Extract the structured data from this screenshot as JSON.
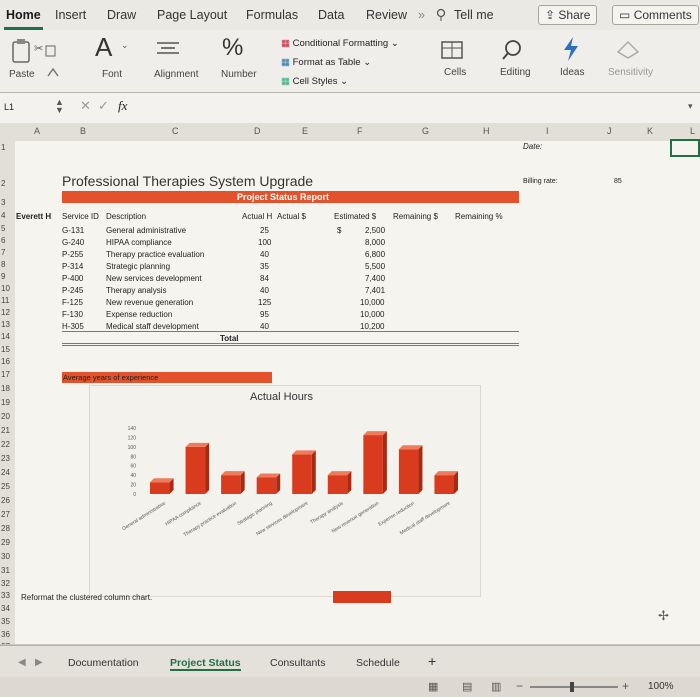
{
  "ribbon_tabs": [
    "Home",
    "Insert",
    "Draw",
    "Page Layout",
    "Formulas",
    "Data",
    "Review"
  ],
  "tell_me": "Tell me",
  "share_label": "Share",
  "comments_label": "Comments",
  "ribbon": {
    "paste": "Paste",
    "font": "Font",
    "alignment": "Alignment",
    "number": "Number",
    "conditional_formatting": "Conditional Formatting",
    "format_as_table": "Format as Table",
    "cell_styles": "Cell Styles",
    "cells": "Cells",
    "editing": "Editing",
    "ideas": "Ideas",
    "sensitivity": "Sensitivity",
    "font_glyph": "A",
    "number_glyph": "%"
  },
  "formula_bar": {
    "name_box": "L1",
    "fx": "fx",
    "formula": ""
  },
  "columns": [
    "A",
    "B",
    "C",
    "D",
    "E",
    "F",
    "G",
    "H",
    "I",
    "J",
    "K",
    "L"
  ],
  "rows": [
    "1",
    "2",
    "3",
    "4",
    "5",
    "6",
    "7",
    "8",
    "9",
    "10",
    "11",
    "12",
    "13",
    "14",
    "15",
    "16",
    "17",
    "18",
    "19",
    "20",
    "21",
    "22",
    "23",
    "24",
    "25",
    "26",
    "27",
    "28",
    "29",
    "30",
    "31",
    "32",
    "33",
    "34",
    "35",
    "36",
    "37"
  ],
  "sheet": {
    "title": "Professional Therapies System Upgrade",
    "banner": "Project Status Report",
    "date_label": "Date:",
    "billing_label": "Billing rate:",
    "billing_value": "85",
    "manager_cut": "Everett H",
    "headers": [
      "Service ID",
      "Description",
      "Actual H",
      "Actual $",
      "Estimated $",
      "Remaining $",
      "Remaining %"
    ],
    "rows": [
      {
        "id": "G-131",
        "desc": "General administrative",
        "hours": "25",
        "est": "2,500"
      },
      {
        "id": "G-240",
        "desc": "HIPAA compliance",
        "hours": "100",
        "est": "8,000"
      },
      {
        "id": "P-255",
        "desc": "Therapy practice evaluation",
        "hours": "40",
        "est": "6,800"
      },
      {
        "id": "P-314",
        "desc": "Strategic planning",
        "hours": "35",
        "est": "5,500"
      },
      {
        "id": "P-400",
        "desc": "New services development",
        "hours": "84",
        "est": "7,400"
      },
      {
        "id": "P-245",
        "desc": "Therapy analysis",
        "hours": "40",
        "est": "7,401"
      },
      {
        "id": "F-125",
        "desc": "New revenue generation",
        "hours": "125",
        "est": "10,000"
      },
      {
        "id": "F-130",
        "desc": "Expense reduction",
        "hours": "95",
        "est": "10,000"
      },
      {
        "id": "H-305",
        "desc": "Medical staff development",
        "hours": "40",
        "est": "10,200"
      }
    ],
    "dollar_sign": "$",
    "total_label": "Total",
    "avg_label": "Average years of experience",
    "instruction": "Reformat the clustered column chart."
  },
  "chart_data": {
    "type": "bar",
    "title": "Actual Hours",
    "categories": [
      "General administrative",
      "HIPAA compliance",
      "Therapy practice evaluation",
      "Strategic planning",
      "New services development",
      "Therapy analysis",
      "New revenue generation",
      "Expense reduction",
      "Medical staff development"
    ],
    "values": [
      25,
      100,
      40,
      35,
      84,
      40,
      125,
      95,
      40
    ],
    "yticks": [
      "140",
      "120",
      "100",
      "80",
      "60",
      "40",
      "20",
      "0"
    ],
    "ylim": [
      0,
      140
    ],
    "bar_color": "#d93b1f"
  },
  "sheet_tabs": [
    "Documentation",
    "Project Status",
    "Consultants",
    "Schedule"
  ],
  "add_sheet": "+",
  "zoom": "100%"
}
